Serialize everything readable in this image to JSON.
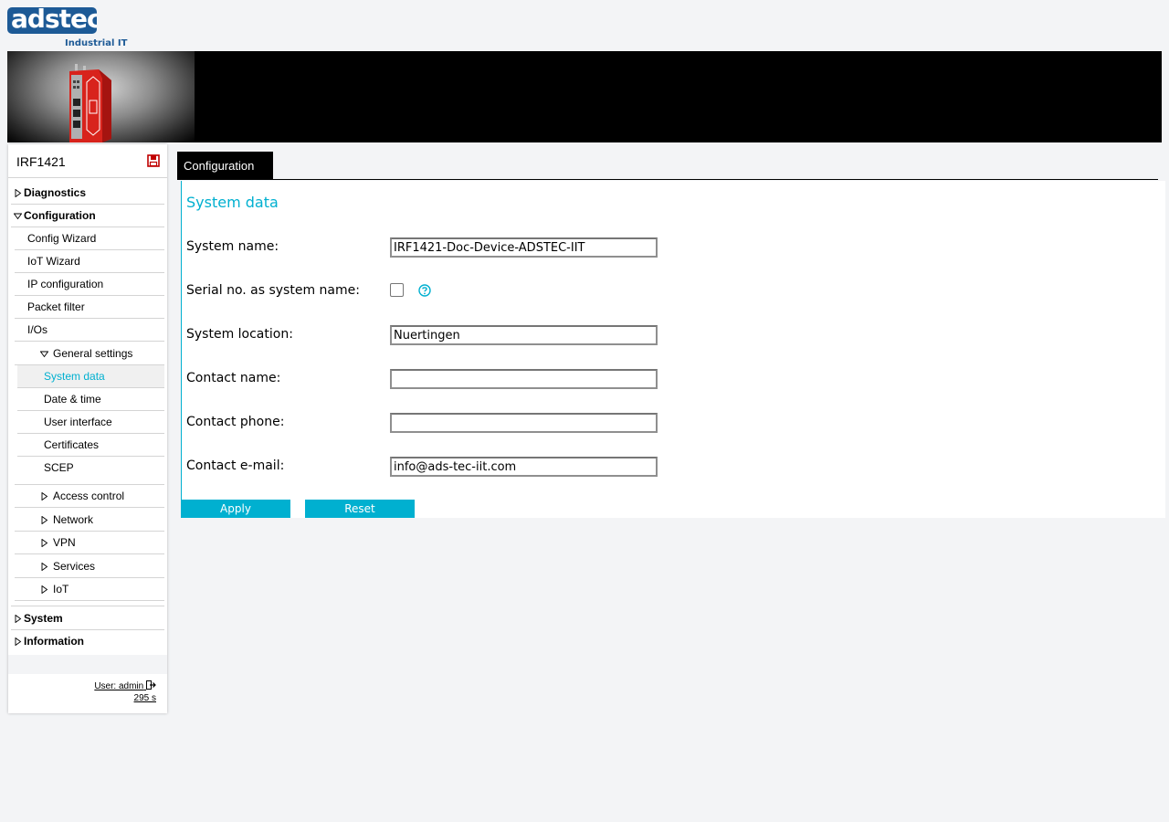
{
  "logo": {
    "brand": "adstec",
    "subtitle": "Industrial IT"
  },
  "sidebar": {
    "device_name": "IRF1421",
    "items": [
      {
        "label": "Diagnostics"
      },
      {
        "label": "Configuration"
      },
      {
        "label": "Config Wizard"
      },
      {
        "label": "IoT Wizard"
      },
      {
        "label": "IP configuration"
      },
      {
        "label": "Packet filter"
      },
      {
        "label": "I/Os"
      },
      {
        "label": "General settings"
      },
      {
        "label": "System data"
      },
      {
        "label": "Date & time"
      },
      {
        "label": "User interface"
      },
      {
        "label": "Certificates"
      },
      {
        "label": "SCEP"
      },
      {
        "label": "Access control"
      },
      {
        "label": "Network"
      },
      {
        "label": "VPN"
      },
      {
        "label": "Services"
      },
      {
        "label": "IoT"
      },
      {
        "label": "System"
      },
      {
        "label": "Information"
      }
    ],
    "user": "User: admin",
    "session": "295 s"
  },
  "tab": {
    "label": "Configuration"
  },
  "form": {
    "title": "System data",
    "fields": [
      {
        "label": "System name:",
        "value": "IRF1421-Doc-Device-ADSTEC-IIT"
      },
      {
        "label": "Serial no. as system name:",
        "checked": false
      },
      {
        "label": "System location:",
        "value": "Nuertingen"
      },
      {
        "label": "Contact name:",
        "value": ""
      },
      {
        "label": "Contact phone:",
        "value": ""
      },
      {
        "label": "Contact e-mail:",
        "value": "info@ads-tec-iit.com"
      }
    ],
    "apply_label": "Apply",
    "reset_label": "Reset"
  },
  "colors": {
    "accent": "#00b0d0",
    "brand": "#1d5a96",
    "device": "#d8231c"
  }
}
